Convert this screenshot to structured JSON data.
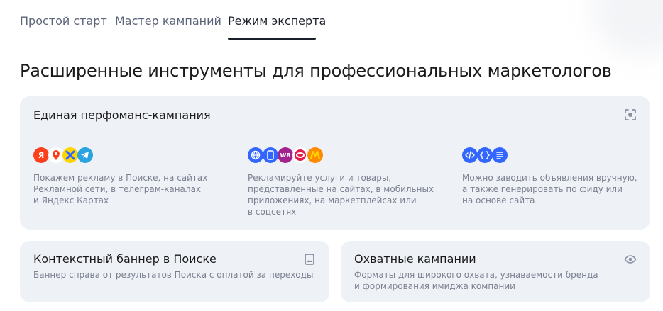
{
  "tabs": [
    {
      "label": "Простой старт",
      "active": false
    },
    {
      "label": "Мастер кампаний",
      "active": false
    },
    {
      "label": "Режим эксперта",
      "active": true
    }
  ],
  "page_title": "Расширенные инструменты для профессиональных маркетологов",
  "performance_card": {
    "title": "Единая перфоманс-кампания",
    "corner_icon": "scan-icon",
    "columns": [
      {
        "icons": [
          "yandex-icon",
          "maps-pin-icon",
          "direct-icon",
          "telegram-icon"
        ],
        "text": "Покажем рекламу в Поиске, на сайтах\nРекламной сети, в телеграм-каналах\nи Яндекс Картах"
      },
      {
        "icons": [
          "globe-icon",
          "mobile-app-icon",
          "wildberries-icon",
          "ozon-icon",
          "market-icon"
        ],
        "badge_wb": "WB",
        "text": "Рекламируйте услуги и товары,\nпредставленные на сайтах, в мобильных\nприложениях, на маркетплейсах или\nв соцсетях"
      },
      {
        "icons": [
          "code-icon",
          "feed-icon",
          "document-icon"
        ],
        "text": "Можно заводить объявления вручную,\nа также генерировать по фиду или\nна основе сайта"
      }
    ]
  },
  "banner_card": {
    "title": "Контекстный баннер в Поиске",
    "desc": "Баннер справа от результатов Поиска с оплатой за переходы",
    "corner_icon": "image-icon"
  },
  "reach_card": {
    "title": "Охватные кампании",
    "desc": "Форматы для широкого охвата, узнаваемости бренда\nи формирования имиджа компании",
    "corner_icon": "eye-icon"
  },
  "colors": {
    "yandex_red": "#fc3f1d",
    "telegram_blue": "#2aa3e0",
    "accent_blue": "#3366ff",
    "wb_purple": "#a3238e",
    "market_yellow": "#ffd600",
    "card_bg": "#eef1f6"
  }
}
